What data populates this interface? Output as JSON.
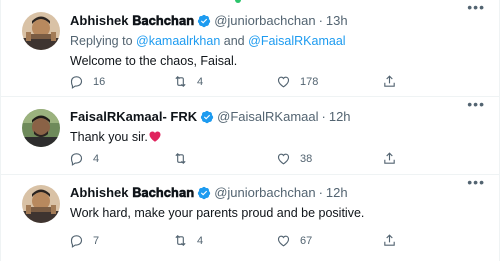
{
  "tweets": [
    {
      "name": "Abhishek 𝐁𝐚𝐜𝐡𝐜𝐡𝐚𝐧",
      "handle": "@juniorbachchan",
      "time": "13h",
      "separator": "·",
      "replying_prefix": "Replying to",
      "replying_mention_1": "@kamaalrkhan",
      "replying_and": "and",
      "replying_mention_2": "@FaisalRKamaal",
      "text": "Welcome to the chaos, Faisal.",
      "replies": "16",
      "retweets": "4",
      "likes": "178",
      "avatar_icon": "profile-photo-abhishek"
    },
    {
      "name": "FaisalRKamaal- FRK",
      "handle": "@FaisalRKamaal",
      "time": "12h",
      "separator": "·",
      "text": "Thank you sir.",
      "emoji": "red-heart",
      "replies": "4",
      "retweets": "",
      "likes": "38",
      "avatar_icon": "profile-photo-faisal"
    },
    {
      "name": "Abhishek 𝐁𝐚𝐜𝐡𝐜𝐡𝐚𝐧",
      "handle": "@juniorbachchan",
      "time": "12h",
      "separator": "·",
      "text": "Work hard, make your parents proud and be positive.",
      "replies": "7",
      "retweets": "4",
      "likes": "67",
      "avatar_icon": "profile-photo-abhishek"
    }
  ],
  "icons": {
    "reply": "reply-icon",
    "retweet": "retweet-icon",
    "like": "like-icon",
    "share": "share-icon",
    "more": "more-icon",
    "verified": "verified-badge-icon"
  },
  "colors": {
    "accent": "#1d9bf0",
    "secondary_text": "#536471",
    "primary_text": "#0f1419",
    "heart": "#e0245e"
  }
}
